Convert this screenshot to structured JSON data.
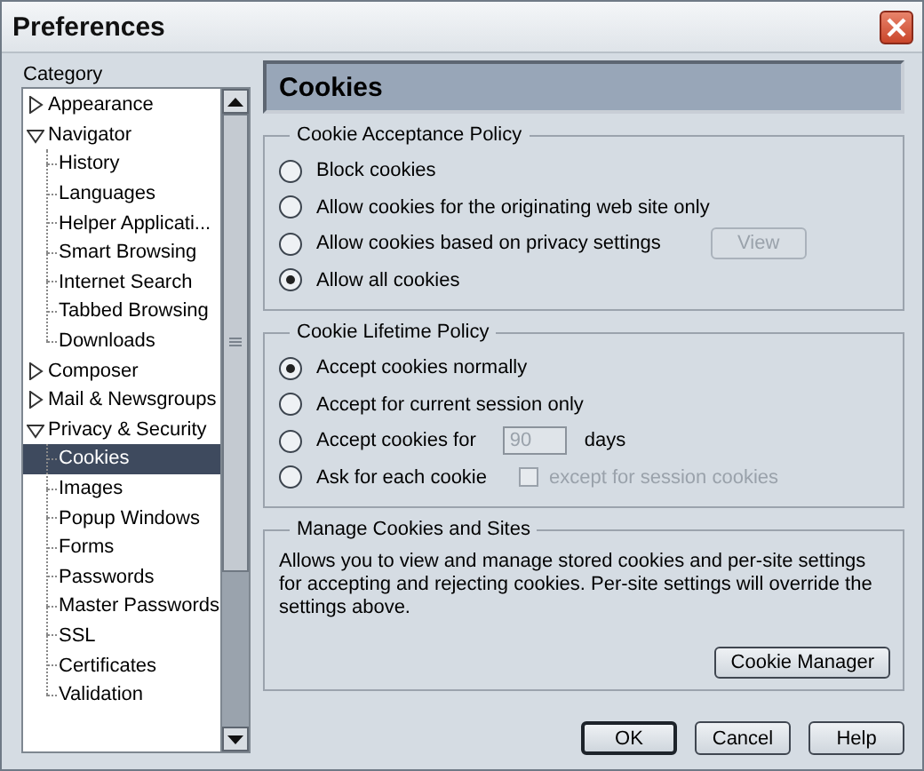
{
  "window": {
    "title": "Preferences"
  },
  "sidebar": {
    "label": "Category",
    "tree": [
      {
        "label": "Appearance",
        "expanded": false,
        "selected": false
      },
      {
        "label": "Navigator",
        "expanded": true,
        "selected": false,
        "children": [
          {
            "label": "History",
            "selected": false
          },
          {
            "label": "Languages",
            "selected": false
          },
          {
            "label": "Helper Applicati...",
            "selected": false
          },
          {
            "label": "Smart Browsing",
            "selected": false
          },
          {
            "label": "Internet Search",
            "selected": false
          },
          {
            "label": "Tabbed Browsing",
            "selected": false
          },
          {
            "label": "Downloads",
            "selected": false
          }
        ]
      },
      {
        "label": "Composer",
        "expanded": false,
        "selected": false
      },
      {
        "label": "Mail & Newsgroups",
        "expanded": false,
        "selected": false
      },
      {
        "label": "Privacy & Security",
        "expanded": true,
        "selected": false,
        "children": [
          {
            "label": "Cookies",
            "selected": true
          },
          {
            "label": "Images",
            "selected": false
          },
          {
            "label": "Popup Windows",
            "selected": false
          },
          {
            "label": "Forms",
            "selected": false
          },
          {
            "label": "Passwords",
            "selected": false
          },
          {
            "label": "Master Passwords",
            "selected": false
          },
          {
            "label": "SSL",
            "selected": false
          },
          {
            "label": "Certificates",
            "selected": false
          },
          {
            "label": "Validation",
            "selected": false
          }
        ]
      }
    ]
  },
  "panel": {
    "title": "Cookies",
    "groups": [
      {
        "legend": "Cookie Acceptance Policy",
        "options": [
          {
            "label": "Block cookies",
            "selected": false
          },
          {
            "label": "Allow cookies for the originating web site only",
            "selected": false
          },
          {
            "label": "Allow cookies based on privacy settings",
            "selected": false,
            "button": {
              "label": "View",
              "disabled": true
            }
          },
          {
            "label": "Allow all cookies",
            "selected": true
          }
        ]
      },
      {
        "legend": "Cookie Lifetime Policy",
        "options": [
          {
            "label": "Accept cookies normally",
            "selected": true
          },
          {
            "label": "Accept for current session only",
            "selected": false
          },
          {
            "label": "Accept cookies for",
            "selected": false,
            "field": {
              "value": "90",
              "disabled": true,
              "suffix": "days"
            }
          },
          {
            "label": "Ask for each cookie",
            "selected": false,
            "checkbox": {
              "label": "except for session cookies",
              "checked": false,
              "disabled": true
            }
          }
        ]
      },
      {
        "legend": "Manage Cookies and Sites",
        "description": "Allows you to view and manage stored cookies and per-site settings for accepting and rejecting cookies. Per-site settings will override the settings above.",
        "button": {
          "label": "Cookie Manager"
        }
      }
    ]
  },
  "buttons": [
    {
      "label": "OK",
      "default": true
    },
    {
      "label": "Cancel",
      "default": false
    },
    {
      "label": "Help",
      "default": false
    }
  ]
}
